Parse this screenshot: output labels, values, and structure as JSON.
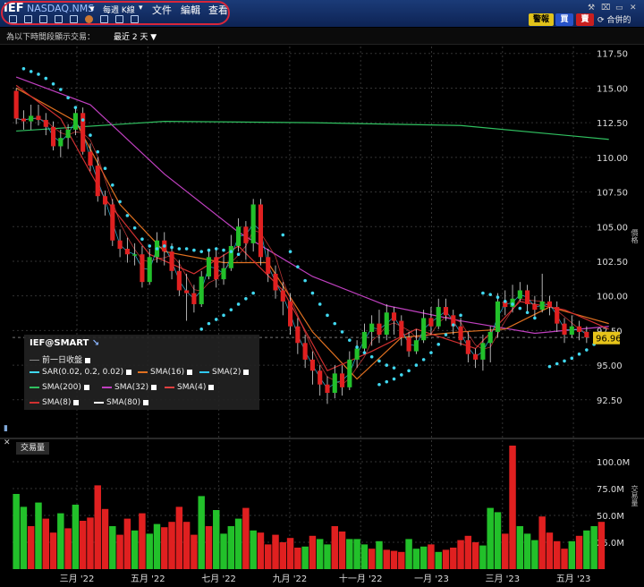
{
  "titlebar": {
    "ticker": "IEF",
    "exchange": "NASDAQ.NMS",
    "period_select": "每週 K線",
    "menu": [
      "文件",
      "編輯",
      "查看"
    ],
    "buttons": {
      "alert": "警報",
      "buy": "買",
      "sell": "賣"
    },
    "linked": "合併的",
    "accent_oval": "#d8263a"
  },
  "infobar": {
    "label": "為以下時間段顯示交易：",
    "value": "最近 2 天 ▼"
  },
  "legend": {
    "header": "IEF@SMART",
    "rows": [
      {
        "label": "前一日收盤",
        "color": "#888888"
      },
      {
        "label": "SAR(0.02, 0.2, 0.02)",
        "color": "#40d8f0"
      },
      {
        "label": "SMA(16)",
        "color": "#e07020"
      },
      {
        "label": "SMA(2)",
        "color": "#30c8f0"
      },
      {
        "label": "SMA(200)",
        "color": "#30c060"
      },
      {
        "label": "SMA(32)",
        "color": "#c040c0"
      },
      {
        "label": "SMA(4)",
        "color": "#e04040"
      },
      {
        "label": "SMA(8)",
        "color": "#d03030"
      },
      {
        "label": "SMA(80)",
        "color": "#ffffff"
      }
    ]
  },
  "price_axis_label": "價格",
  "last_price": "96.96",
  "volume_panel": {
    "label": "交易量",
    "axis_label": "交易量"
  },
  "chart_data": {
    "type": "candlestick",
    "price_ylim": [
      91.0,
      118.0
    ],
    "price_ticks": [
      "117.50",
      "115.00",
      "112.50",
      "110.00",
      "107.50",
      "105.00",
      "102.50",
      "100.00",
      "97.50",
      "95.00",
      "92.50"
    ],
    "volume_ylim": [
      0,
      120
    ],
    "volume_ticks": [
      "100.0M",
      "75.0M",
      "50.0M",
      "25.0M"
    ],
    "x_ticks": [
      "三月 '22",
      "五月 '22",
      "七月 '22",
      "九月 '22",
      "十一月 '22",
      "一月 '23",
      "三月 '23",
      "五月 '23"
    ],
    "up_color": "#22c02a",
    "down_color": "#e02020",
    "candles": [
      [
        114.8,
        112.8,
        115.0,
        112.4
      ],
      [
        112.8,
        112.6,
        113.4,
        112.0
      ],
      [
        112.6,
        113.0,
        113.8,
        112.0
      ],
      [
        113.0,
        112.7,
        113.8,
        112.3
      ],
      [
        112.7,
        112.2,
        113.2,
        111.6
      ],
      [
        112.2,
        110.8,
        112.6,
        110.5
      ],
      [
        110.8,
        111.4,
        112.0,
        110.0
      ],
      [
        111.4,
        112.0,
        112.4,
        110.6
      ],
      [
        112.0,
        113.2,
        113.6,
        111.6
      ],
      [
        113.2,
        110.4,
        113.6,
        110.2
      ],
      [
        110.4,
        109.4,
        111.0,
        109.0
      ],
      [
        109.4,
        107.2,
        110.0,
        106.8
      ],
      [
        107.2,
        106.6,
        107.6,
        105.8
      ],
      [
        106.6,
        104.0,
        107.0,
        103.6
      ],
      [
        104.0,
        103.4,
        104.8,
        102.8
      ],
      [
        103.4,
        103.0,
        104.2,
        102.4
      ],
      [
        103.0,
        103.0,
        103.8,
        102.2
      ],
      [
        103.0,
        101.0,
        103.6,
        100.6
      ],
      [
        101.0,
        102.8,
        103.4,
        100.8
      ],
      [
        102.8,
        104.0,
        104.6,
        102.4
      ],
      [
        104.0,
        103.2,
        104.6,
        102.2
      ],
      [
        103.2,
        101.8,
        103.8,
        101.2
      ],
      [
        101.8,
        100.4,
        102.6,
        100.0
      ],
      [
        100.4,
        100.2,
        101.6,
        98.2
      ],
      [
        100.2,
        99.4,
        100.8,
        98.8
      ],
      [
        99.4,
        101.4,
        101.8,
        99.2
      ],
      [
        101.4,
        102.8,
        103.4,
        101.2
      ],
      [
        102.8,
        101.2,
        103.4,
        100.6
      ],
      [
        101.2,
        102.0,
        103.0,
        100.8
      ],
      [
        102.0,
        103.6,
        104.4,
        101.8
      ],
      [
        103.6,
        105.0,
        105.6,
        103.2
      ],
      [
        105.0,
        103.8,
        105.4,
        102.6
      ],
      [
        103.8,
        106.6,
        107.0,
        103.2
      ],
      [
        106.6,
        102.8,
        107.0,
        102.2
      ],
      [
        102.8,
        101.6,
        103.4,
        101.0
      ],
      [
        101.6,
        100.4,
        102.2,
        99.8
      ],
      [
        100.4,
        99.6,
        101.0,
        98.6
      ],
      [
        99.6,
        97.8,
        100.2,
        97.2
      ],
      [
        97.8,
        96.6,
        98.4,
        95.8
      ],
      [
        96.6,
        95.4,
        97.2,
        94.8
      ],
      [
        95.4,
        94.6,
        96.0,
        93.6
      ],
      [
        94.6,
        93.6,
        95.0,
        92.8
      ],
      [
        93.6,
        93.0,
        94.2,
        92.2
      ],
      [
        93.0,
        94.4,
        95.0,
        92.6
      ],
      [
        94.4,
        93.4,
        95.0,
        92.8
      ],
      [
        93.4,
        95.4,
        96.0,
        93.2
      ],
      [
        95.4,
        96.2,
        96.8,
        94.8
      ],
      [
        96.2,
        97.4,
        98.0,
        95.8
      ],
      [
        97.4,
        98.0,
        98.6,
        96.4
      ],
      [
        98.0,
        97.2,
        99.0,
        96.6
      ],
      [
        97.2,
        98.8,
        99.4,
        96.8
      ],
      [
        98.8,
        98.2,
        99.2,
        97.2
      ],
      [
        98.2,
        97.0,
        98.6,
        96.4
      ],
      [
        97.0,
        96.0,
        97.4,
        95.6
      ],
      [
        96.0,
        96.8,
        97.6,
        95.8
      ],
      [
        96.8,
        98.4,
        99.0,
        96.6
      ],
      [
        98.4,
        97.8,
        99.2,
        97.2
      ],
      [
        97.8,
        99.2,
        99.8,
        97.6
      ],
      [
        99.2,
        98.6,
        99.8,
        98.2
      ],
      [
        98.6,
        97.8,
        99.0,
        97.2
      ],
      [
        97.8,
        96.8,
        98.4,
        96.4
      ],
      [
        96.8,
        95.8,
        97.4,
        95.2
      ],
      [
        95.8,
        95.4,
        96.2,
        94.8
      ],
      [
        95.4,
        96.6,
        97.2,
        94.6
      ],
      [
        96.6,
        97.4,
        97.8,
        95.2
      ],
      [
        97.4,
        99.6,
        100.2,
        97.0
      ],
      [
        99.6,
        99.2,
        100.4,
        98.6
      ],
      [
        99.2,
        99.8,
        100.8,
        98.8
      ],
      [
        99.8,
        100.4,
        101.0,
        99.6
      ],
      [
        100.4,
        99.4,
        100.8,
        98.8
      ],
      [
        99.4,
        99.0,
        100.0,
        98.4
      ],
      [
        99.0,
        99.6,
        101.6,
        98.8
      ],
      [
        99.6,
        99.2,
        100.0,
        98.6
      ],
      [
        99.2,
        98.0,
        99.6,
        97.4
      ],
      [
        98.0,
        97.2,
        98.4,
        96.6
      ],
      [
        97.2,
        97.8,
        98.6,
        97.0
      ],
      [
        97.8,
        97.4,
        98.2,
        96.8
      ],
      [
        97.4,
        97.0,
        97.8,
        96.6
      ]
    ],
    "volumes": [
      70,
      58,
      40,
      62,
      47,
      34,
      52,
      38,
      60,
      45,
      48,
      78,
      56,
      40,
      32,
      47,
      36,
      52,
      33,
      42,
      39,
      44,
      58,
      44,
      32,
      68,
      40,
      55,
      33,
      40,
      47,
      57,
      36,
      34,
      23,
      32,
      25,
      29,
      20,
      21,
      31,
      28,
      23,
      40,
      35,
      28,
      28,
      23,
      19,
      26,
      18,
      17,
      16,
      28,
      19,
      21,
      23,
      16,
      18,
      20,
      27,
      31,
      25,
      22,
      57,
      53,
      33,
      115,
      40,
      33,
      27,
      49,
      34,
      26,
      19,
      26,
      31,
      36,
      40,
      44
    ],
    "volume_up": [
      true,
      true,
      false,
      true,
      false,
      false,
      true,
      false,
      true,
      false,
      false,
      false,
      false,
      true,
      false,
      false,
      true,
      false,
      true,
      true,
      false,
      false,
      false,
      false,
      false,
      true,
      false,
      true,
      true,
      true,
      true,
      false,
      true,
      false,
      false,
      false,
      false,
      false,
      false,
      true,
      false,
      true,
      true,
      false,
      false,
      true,
      true,
      true,
      false,
      true,
      false,
      false,
      false,
      true,
      true,
      true,
      false,
      true,
      false,
      false,
      false,
      false,
      false,
      true,
      true,
      true,
      false,
      false,
      true,
      true,
      true,
      false,
      false,
      false,
      false,
      true,
      false,
      true,
      true,
      false
    ],
    "lines": {
      "sma200": [
        [
          0,
          111.9
        ],
        [
          20,
          112.6
        ],
        [
          40,
          112.5
        ],
        [
          60,
          112.3
        ],
        [
          80,
          111.3
        ]
      ],
      "sma32": [
        [
          0,
          115.8
        ],
        [
          10,
          113.8
        ],
        [
          20,
          108.8
        ],
        [
          30,
          104.6
        ],
        [
          40,
          101.4
        ],
        [
          50,
          99.3
        ],
        [
          60,
          98.2
        ],
        [
          70,
          97.3
        ],
        [
          80,
          97.8
        ]
      ],
      "sma16": [
        [
          0,
          115.0
        ],
        [
          8,
          112.6
        ],
        [
          14,
          106.6
        ],
        [
          20,
          103.2
        ],
        [
          28,
          102.4
        ],
        [
          34,
          102.4
        ],
        [
          40,
          97.4
        ],
        [
          46,
          94.0
        ],
        [
          52,
          97.0
        ],
        [
          60,
          97.4
        ],
        [
          66,
          97.6
        ],
        [
          72,
          99.2
        ],
        [
          80,
          98.0
        ]
      ],
      "sma8": [
        [
          0,
          115.2
        ],
        [
          6,
          112.8
        ],
        [
          12,
          107.0
        ],
        [
          18,
          103.0
        ],
        [
          24,
          101.6
        ],
        [
          30,
          103.6
        ],
        [
          36,
          100.4
        ],
        [
          42,
          94.6
        ],
        [
          48,
          96.0
        ],
        [
          54,
          97.6
        ],
        [
          62,
          96.2
        ],
        [
          68,
          99.6
        ],
        [
          74,
          99.0
        ],
        [
          80,
          97.6
        ]
      ]
    },
    "sar": [
      [
        1,
        116.4
      ],
      [
        2,
        116.2
      ],
      [
        3,
        116.0
      ],
      [
        4,
        115.7
      ],
      [
        5,
        115.3
      ],
      [
        6,
        114.9
      ],
      [
        7,
        114.3
      ],
      [
        8,
        113.6
      ],
      [
        9,
        112.7
      ],
      [
        10,
        111.6
      ],
      [
        11,
        110.4
      ],
      [
        12,
        109.2
      ],
      [
        13,
        108.0
      ],
      [
        14,
        106.8
      ],
      [
        15,
        105.8
      ],
      [
        16,
        104.9
      ],
      [
        17,
        104.1
      ],
      [
        18,
        103.6
      ],
      [
        19,
        103.4
      ],
      [
        20,
        103.6
      ],
      [
        21,
        103.5
      ],
      [
        22,
        103.4
      ],
      [
        23,
        103.4
      ],
      [
        24,
        103.3
      ],
      [
        25,
        103.2
      ],
      [
        26,
        103.3
      ],
      [
        27,
        103.4
      ],
      [
        28,
        103.3
      ],
      [
        29,
        103.2
      ],
      [
        30,
        103.0
      ],
      [
        25,
        97.6
      ],
      [
        26,
        98.0
      ],
      [
        27,
        98.3
      ],
      [
        28,
        98.6
      ],
      [
        29,
        99.0
      ],
      [
        30,
        99.4
      ],
      [
        31,
        99.8
      ],
      [
        32,
        100.2
      ],
      [
        36,
        104.4
      ],
      [
        37,
        103.2
      ],
      [
        38,
        102.1
      ],
      [
        39,
        101.1
      ],
      [
        40,
        100.2
      ],
      [
        41,
        99.4
      ],
      [
        42,
        98.6
      ],
      [
        43,
        98.0
      ],
      [
        44,
        97.4
      ],
      [
        45,
        96.8
      ],
      [
        46,
        96.3
      ],
      [
        47,
        95.9
      ],
      [
        48,
        95.6
      ],
      [
        49,
        95.3
      ],
      [
        50,
        95.0
      ],
      [
        51,
        94.8
      ],
      [
        49,
        93.6
      ],
      [
        50,
        93.8
      ],
      [
        51,
        94.0
      ],
      [
        52,
        94.3
      ],
      [
        53,
        94.6
      ],
      [
        54,
        95.0
      ],
      [
        55,
        95.4
      ],
      [
        56,
        95.9
      ],
      [
        57,
        96.5
      ],
      [
        58,
        97.2
      ],
      [
        59,
        97.9
      ],
      [
        60,
        98.6
      ],
      [
        63,
        100.2
      ],
      [
        64,
        100.1
      ],
      [
        65,
        99.9
      ],
      [
        66,
        99.6
      ],
      [
        67,
        99.4
      ],
      [
        68,
        99.1
      ],
      [
        69,
        98.8
      ],
      [
        70,
        98.4
      ],
      [
        72,
        94.9
      ],
      [
        73,
        95.1
      ],
      [
        74,
        95.3
      ],
      [
        75,
        95.5
      ],
      [
        76,
        95.8
      ],
      [
        77,
        96.1
      ],
      [
        78,
        96.5
      ],
      [
        79,
        96.9
      ]
    ]
  }
}
